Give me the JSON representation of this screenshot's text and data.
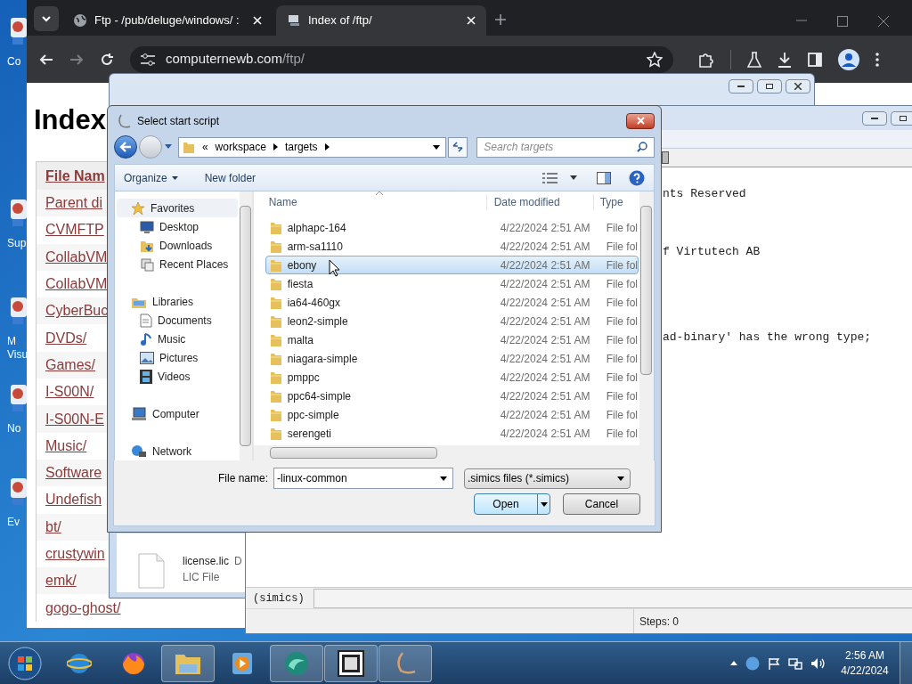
{
  "desktop": {
    "icons": [
      {
        "label": "Co"
      },
      {
        "label": "Sup"
      },
      {
        "label": "M Visu"
      },
      {
        "label": "No"
      },
      {
        "label": "Ev"
      }
    ]
  },
  "browser": {
    "tabs": [
      {
        "title": "Ftp - /pub/deluge/windows/ :",
        "selected": false
      },
      {
        "title": "Index of /ftp/",
        "selected": true
      }
    ],
    "address": {
      "host": "computernewb.com",
      "path": "/ftp/"
    },
    "page": {
      "heading": "Index",
      "table": {
        "columns": [
          "File Nam"
        ],
        "rows": [
          "Parent di",
          "CVMFTP",
          "CollabVM",
          "CollabVM",
          "CyberBuc",
          "DVDs/",
          "Games/",
          "I-S00N/",
          "I-S00N-E",
          "Music/",
          "Software",
          "Undefish",
          "bt/",
          "crustywin",
          "emk/",
          "gogo-ghost/"
        ]
      }
    }
  },
  "explorer_window": {
    "file": {
      "name": "license.lic",
      "column_2": "D",
      "type": "LIC File"
    }
  },
  "console_window": {
    "output": [
      "nts Reserved",
      "f Virtutech AB",
      "ad-binary' has the wrong type;"
    ],
    "prompt": "(simics)",
    "status": "Steps: 0"
  },
  "dialog": {
    "title": "Select start script",
    "breadcrumb": [
      "«",
      "workspace",
      "targets"
    ],
    "search": {
      "placeholder": "Search targets"
    },
    "toolbar": {
      "organize": "Organize",
      "new_folder": "New folder"
    },
    "nav": [
      {
        "label": "Favorites",
        "selected": true,
        "children": [
          {
            "label": "Desktop",
            "selected": false
          },
          {
            "label": "Downloads",
            "selected": false
          },
          {
            "label": "Recent Places",
            "selected": false
          }
        ]
      },
      {
        "label": "Libraries",
        "selected": false,
        "children": [
          {
            "label": "Documents",
            "selected": false
          },
          {
            "label": "Music",
            "selected": false
          },
          {
            "label": "Pictures",
            "selected": false
          },
          {
            "label": "Videos",
            "selected": false
          }
        ]
      },
      {
        "label": "Computer",
        "selected": false
      },
      {
        "label": "Network",
        "selected": false
      }
    ],
    "columns": [
      "Name",
      "Date modified",
      "Type"
    ],
    "rows": [
      {
        "name": "alphapc-164",
        "date": "4/22/2024 2:51 AM",
        "type": "File fol",
        "selected": false
      },
      {
        "name": "arm-sa1110",
        "date": "4/22/2024 2:51 AM",
        "type": "File fol",
        "selected": false
      },
      {
        "name": "ebony",
        "date": "4/22/2024 2:51 AM",
        "type": "File fol",
        "selected": true
      },
      {
        "name": "fiesta",
        "date": "4/22/2024 2:51 AM",
        "type": "File fol",
        "selected": false
      },
      {
        "name": "ia64-460gx",
        "date": "4/22/2024 2:51 AM",
        "type": "File fol",
        "selected": false
      },
      {
        "name": "leon2-simple",
        "date": "4/22/2024 2:51 AM",
        "type": "File fol",
        "selected": false
      },
      {
        "name": "malta",
        "date": "4/22/2024 2:51 AM",
        "type": "File fol",
        "selected": false
      },
      {
        "name": "niagara-simple",
        "date": "4/22/2024 2:51 AM",
        "type": "File fol",
        "selected": false
      },
      {
        "name": "pmppc",
        "date": "4/22/2024 2:51 AM",
        "type": "File fol",
        "selected": false
      },
      {
        "name": "ppc64-simple",
        "date": "4/22/2024 2:51 AM",
        "type": "File fol",
        "selected": false
      },
      {
        "name": "ppc-simple",
        "date": "4/22/2024 2:51 AM",
        "type": "File fol",
        "selected": false
      },
      {
        "name": "serengeti",
        "date": "4/22/2024 2:51 AM",
        "type": "File fol",
        "selected": false
      }
    ],
    "file_name_label": "File name:",
    "file_name": "-linux-common",
    "filter": ".simics files (*.simics)",
    "open": "Open",
    "cancel": "Cancel"
  },
  "taskbar": {
    "items": [
      {
        "running": false
      },
      {
        "running": false
      },
      {
        "running": true
      },
      {
        "running": false
      },
      {
        "running": true
      },
      {
        "running": true
      },
      {
        "running": true
      }
    ],
    "clock": {
      "time": "2:56 AM",
      "date": "4/22/2024"
    }
  }
}
